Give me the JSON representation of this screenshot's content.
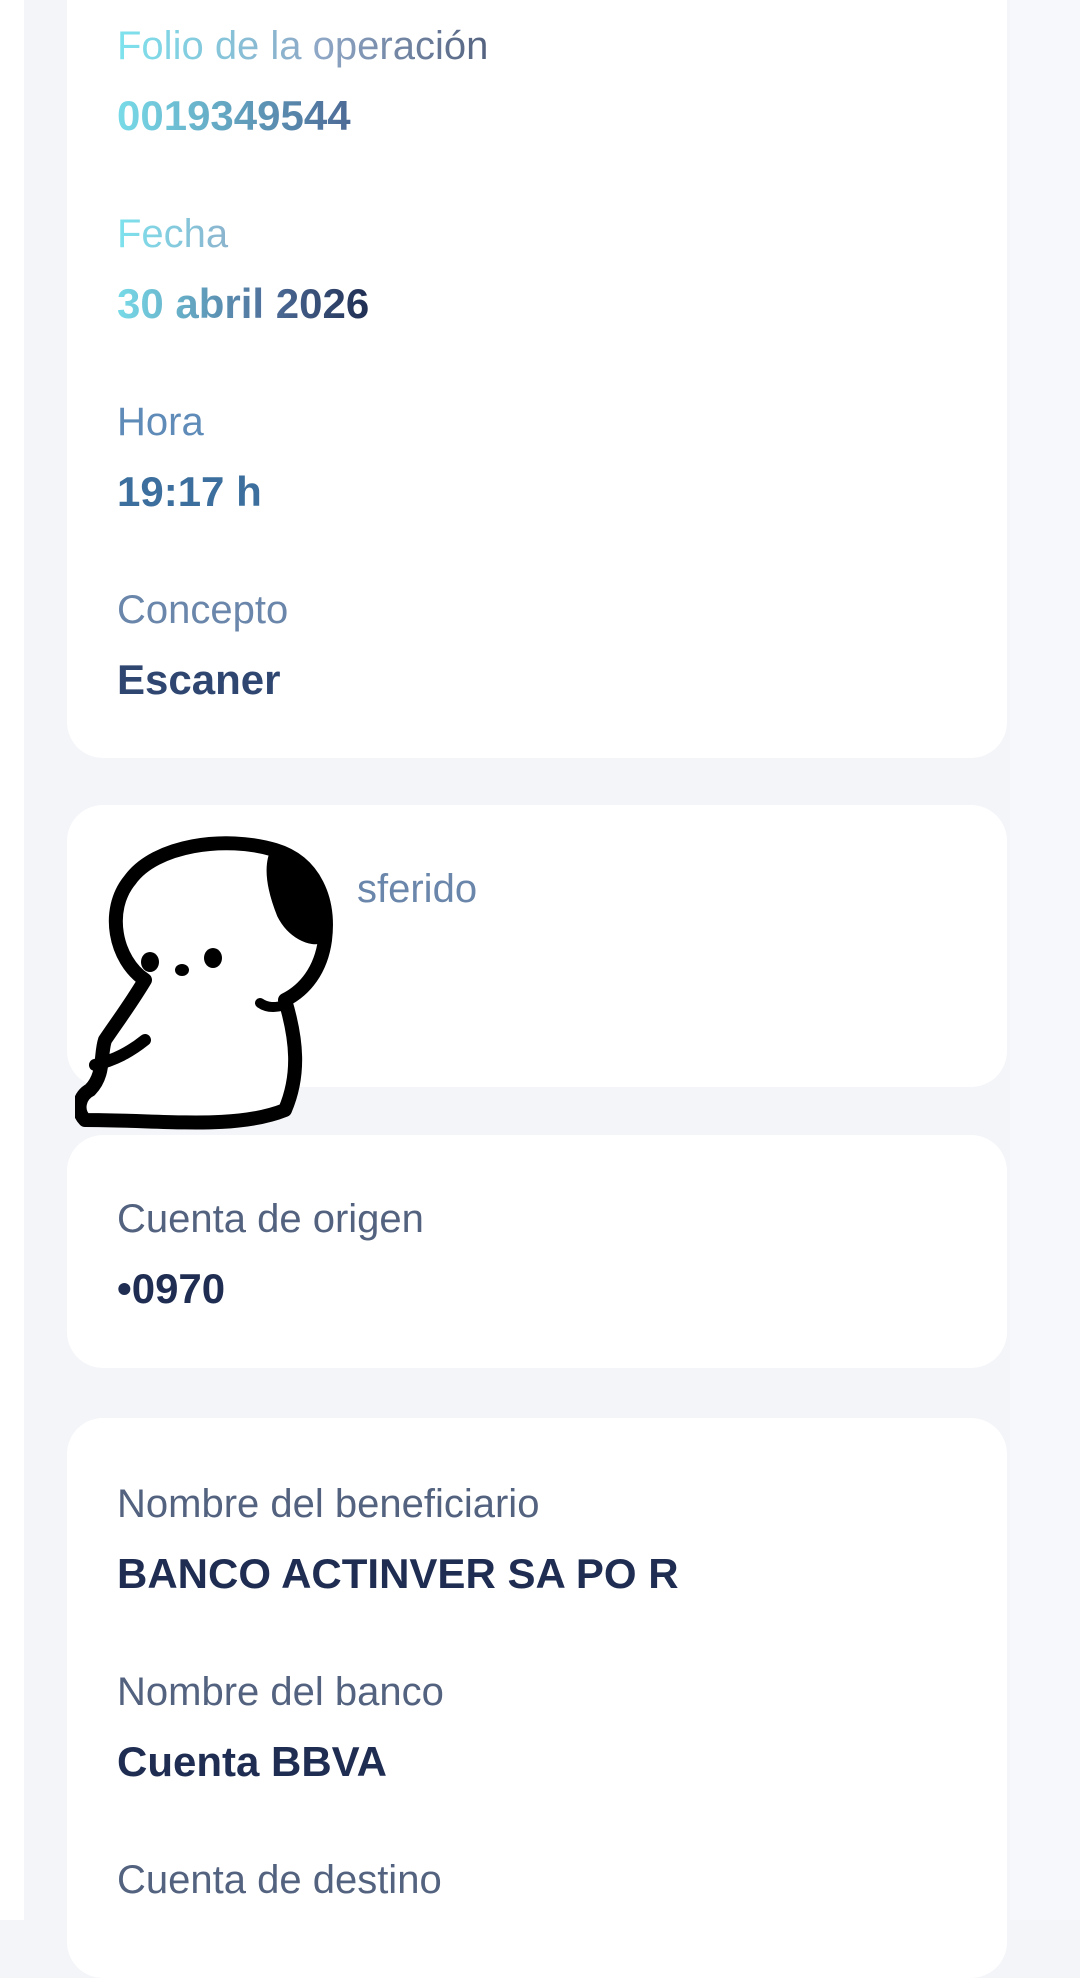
{
  "operation": {
    "folio": {
      "label": "Folio de la operación",
      "value": "0019349544"
    },
    "fecha": {
      "label": "Fecha",
      "value": "30 abril 2026"
    },
    "hora": {
      "label": "Hora",
      "value": "19:17 h"
    },
    "concepto": {
      "label": "Concepto",
      "value": "Escaner"
    }
  },
  "transfer": {
    "label_partial": "sferido"
  },
  "origin": {
    "label": "Cuenta de origen",
    "value": "•0970"
  },
  "beneficiary": {
    "name_label": "Nombre del beneficiario",
    "name_value": "BANCO ACTINVER SA PO R",
    "bank_label": "Nombre del banco",
    "bank_value": "Cuenta BBVA",
    "dest_label": "Cuenta de destino"
  },
  "sticker": {
    "icon": "puppy-sticker-icon"
  },
  "colors": {
    "text_dark": "#1f2d52",
    "text_label": "#53627f",
    "background": "#f4f5f9",
    "card": "#ffffff"
  }
}
